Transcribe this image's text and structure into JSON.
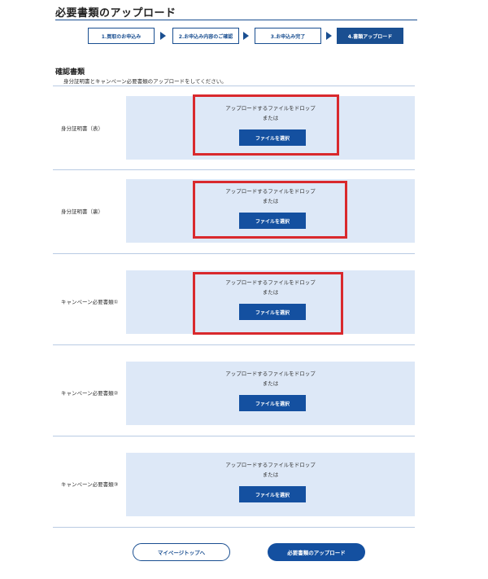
{
  "page": {
    "title": "必要書類のアップロード"
  },
  "steps": [
    {
      "label": "1.買取のお申込み",
      "active": false
    },
    {
      "label": "2.お申込み内容のご確認",
      "active": false
    },
    {
      "label": "3.お申込み完了",
      "active": false
    },
    {
      "label": "4.書類アップロード",
      "active": true
    }
  ],
  "section": {
    "heading": "確認書類",
    "description": "身分証明書とキャンペーン必要書類のアップロードをしてください。"
  },
  "documents": [
    {
      "label": "身分証明書（表）",
      "drop_text": "アップロードするファイルをドロップ",
      "or_text": "または",
      "button": "ファイルを選択",
      "highlighted": true
    },
    {
      "label": "身分証明書（裏）",
      "drop_text": "アップロードするファイルをドロップ",
      "or_text": "または",
      "button": "ファイルを選択",
      "highlighted": true
    },
    {
      "label": "キャンペーン必要書類①",
      "drop_text": "アップロードするファイルをドロップ",
      "or_text": "または",
      "button": "ファイルを選択",
      "highlighted": true
    },
    {
      "label": "キャンペーン必要書類②",
      "drop_text": "アップロードするファイルをドロップ",
      "or_text": "または",
      "button": "ファイルを選択",
      "highlighted": false
    },
    {
      "label": "キャンペーン必要書類③",
      "drop_text": "アップロードするファイルをドロップ",
      "or_text": "または",
      "button": "ファイルを選択",
      "highlighted": false
    }
  ],
  "actions": {
    "mypage": "マイページトップへ",
    "upload": "必要書類のアップロード"
  },
  "colors": {
    "primary": "#1450a0",
    "dropzone": "#dde8f7",
    "highlight": "#d9292d"
  }
}
